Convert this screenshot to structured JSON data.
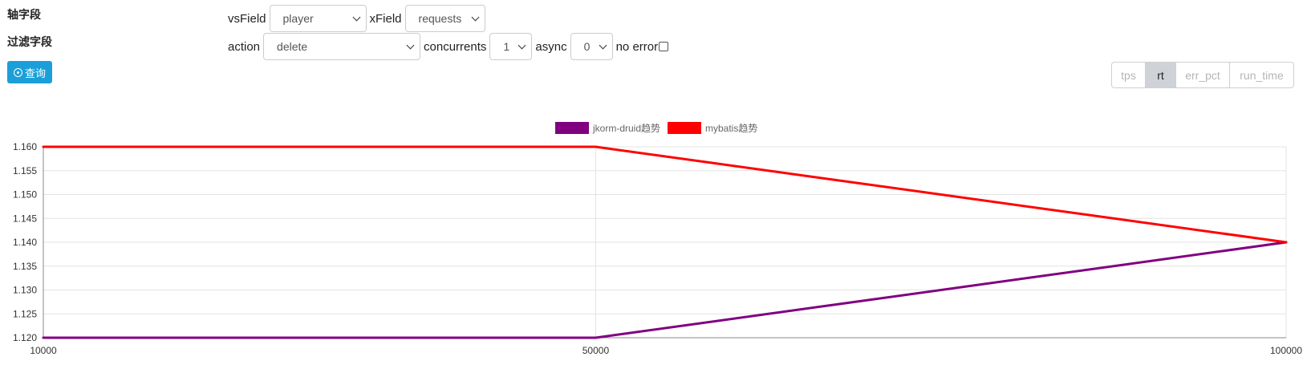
{
  "form": {
    "axis_label": "轴字段",
    "filter_label": "过滤字段",
    "query_label": "查询",
    "vs_field_label": "vsField",
    "vs_field_value": "player",
    "x_field_label": "xField",
    "x_field_value": "requests",
    "action_label": "action",
    "action_value": "delete",
    "concurrents_label": "concurrents",
    "concurrents_value": "1",
    "async_label": "async",
    "async_value": "0",
    "no_error_label": "no error",
    "no_error_checked": false
  },
  "metrics": {
    "buttons": [
      "tps",
      "rt",
      "err_pct",
      "run_time"
    ],
    "active": "rt"
  },
  "chart_data": {
    "type": "line",
    "x": [
      10000,
      50000,
      100000
    ],
    "series": [
      {
        "name": "jkorm-druid趋势",
        "color": "#800080",
        "values": [
          1.12,
          1.12,
          1.14
        ]
      },
      {
        "name": "mybatis趋势",
        "color": "#ff0000",
        "values": [
          1.16,
          1.16,
          1.14
        ]
      }
    ],
    "ylim": [
      1.12,
      1.16
    ],
    "yticks": [
      "1.120",
      "1.125",
      "1.130",
      "1.135",
      "1.140",
      "1.145",
      "1.150",
      "1.155",
      "1.160"
    ],
    "xticks": [
      "10000",
      "50000",
      "100000"
    ],
    "grid": true,
    "legend": "top-center"
  }
}
